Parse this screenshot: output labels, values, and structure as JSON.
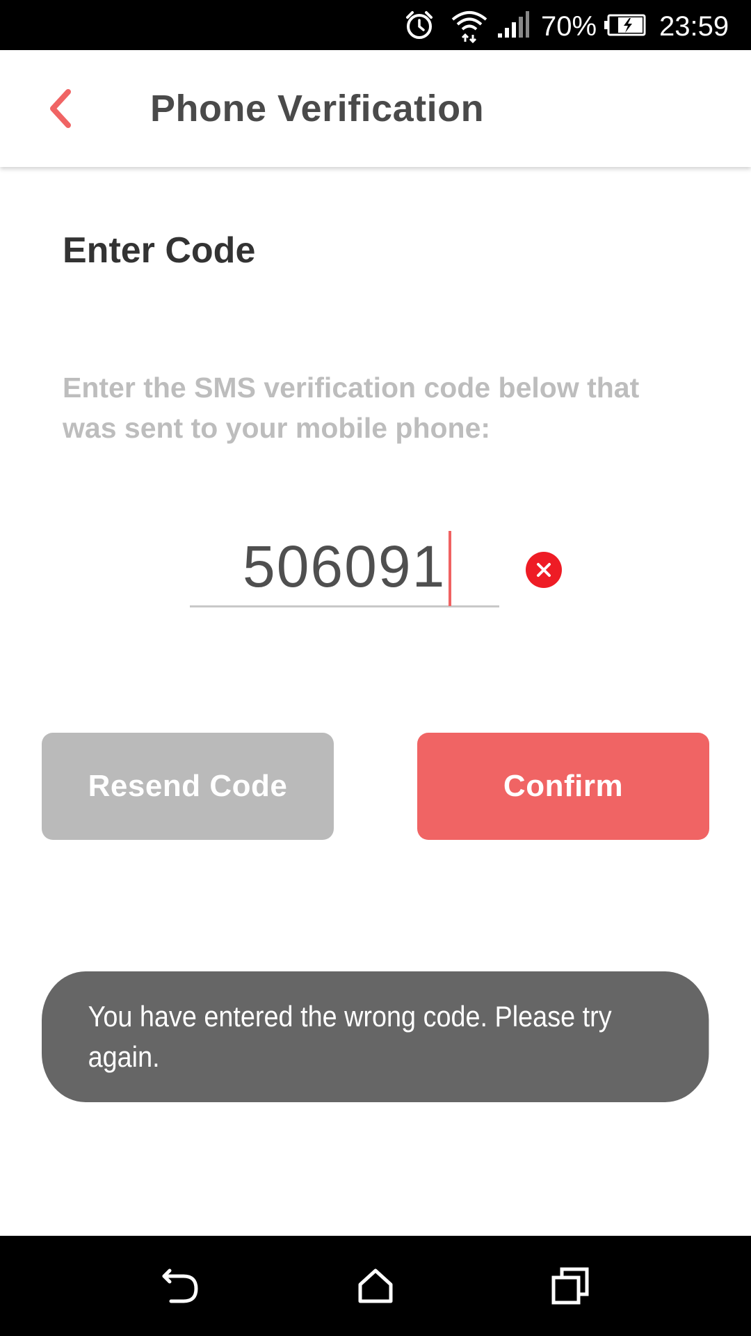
{
  "status_bar": {
    "battery_percent": "70%",
    "time": "23:59",
    "icons": [
      "alarm-icon",
      "wifi-icon",
      "signal-icon",
      "battery-charging-icon"
    ]
  },
  "app_bar": {
    "title": "Phone Verification",
    "back_icon": "chevron-left-icon"
  },
  "content": {
    "section_title": "Enter Code",
    "instructions": "Enter the SMS verification code below that was sent to your mobile phone:",
    "code_value": "506091",
    "clear_icon": "clear-circle-icon"
  },
  "buttons": {
    "resend_label": "Resend Code",
    "confirm_label": "Confirm"
  },
  "toast": {
    "message": "You have entered the wrong code. Please try again."
  },
  "colors": {
    "accent": "#f06464",
    "error": "#ee1c25",
    "disabled": "#bababa",
    "toast_bg": "#666666"
  },
  "nav_bar": {
    "icons": [
      "back-icon",
      "home-icon",
      "recents-icon"
    ]
  }
}
